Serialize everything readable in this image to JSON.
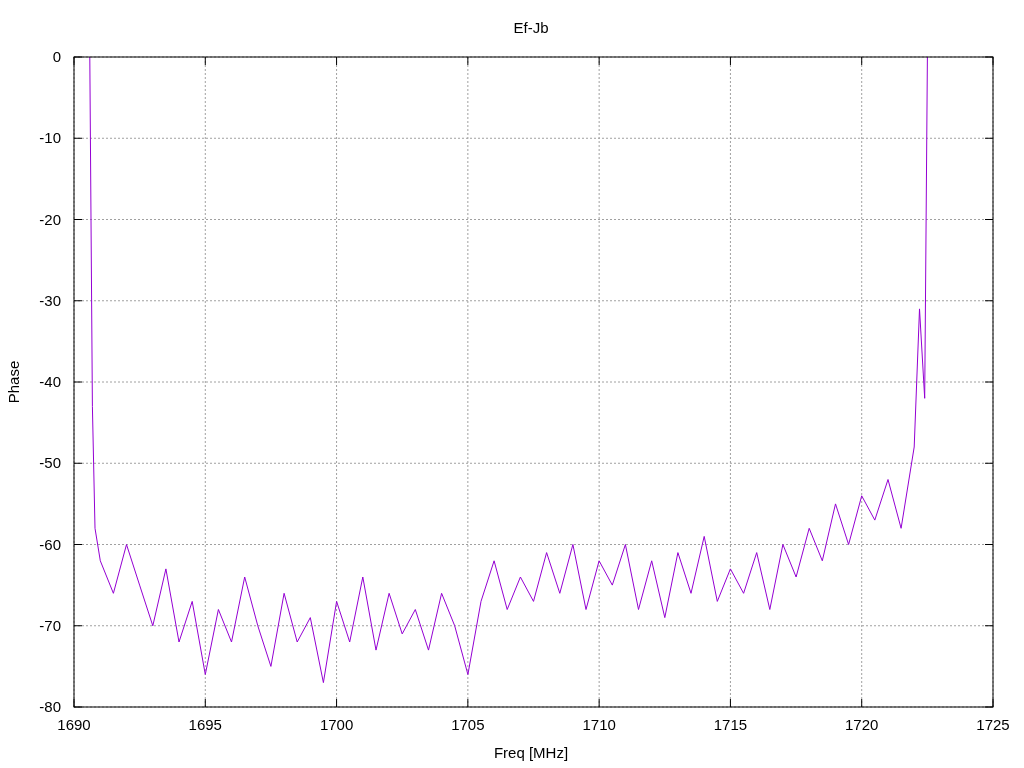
{
  "chart_data": {
    "type": "line",
    "title": "Ef-Jb",
    "xlabel": "Freq [MHz]",
    "ylabel": "Phase",
    "x": [
      1690.6,
      1690.7,
      1690.8,
      1691,
      1691.5,
      1692,
      1692.5,
      1693,
      1693.5,
      1694,
      1694.5,
      1695,
      1695.5,
      1696,
      1696.5,
      1697,
      1697.5,
      1698,
      1698.5,
      1699,
      1699.5,
      1700,
      1700.5,
      1701,
      1701.5,
      1702,
      1702.5,
      1703,
      1703.5,
      1704,
      1704.5,
      1705,
      1705.5,
      1706,
      1706.5,
      1707,
      1707.5,
      1708,
      1708.5,
      1709,
      1709.5,
      1710,
      1710.5,
      1711,
      1711.5,
      1712,
      1712.5,
      1713,
      1713.5,
      1714,
      1714.5,
      1715,
      1715.5,
      1716,
      1716.5,
      1717,
      1717.5,
      1718,
      1718.5,
      1719,
      1719.5,
      1720,
      1720.5,
      1721,
      1721.5,
      1722,
      1722.2,
      1722.4,
      1722.5
    ],
    "grid": true,
    "series": [
      {
        "color": "#9400d3",
        "values": [
          0,
          -43,
          -58,
          -62,
          -66,
          -60,
          -65,
          -70,
          -63,
          -72,
          -67,
          -76,
          -68,
          -72,
          -64,
          -70,
          -75,
          -66,
          -72,
          -69,
          -77,
          -67,
          -72,
          -64,
          -73,
          -66,
          -71,
          -68,
          -73,
          -66,
          -70,
          -76,
          -67,
          -62,
          -68,
          -64,
          -67,
          -61,
          -66,
          -60,
          -68,
          -62,
          -65,
          -60,
          -68,
          -62,
          -69,
          -61,
          -66,
          -59,
          -67,
          -63,
          -66,
          -61,
          -68,
          -60,
          -64,
          -58,
          -62,
          -55,
          -60,
          -54,
          -57,
          -52,
          -58,
          -48,
          -31,
          -42,
          0
        ]
      }
    ],
    "xlim": [
      1690,
      1725
    ],
    "ylim": [
      -80,
      0
    ],
    "xticks": [
      1690,
      1695,
      1700,
      1705,
      1710,
      1715,
      1720,
      1725
    ],
    "yticks": [
      0,
      -10,
      -20,
      -30,
      -40,
      -50,
      -60,
      -70,
      -80
    ]
  }
}
